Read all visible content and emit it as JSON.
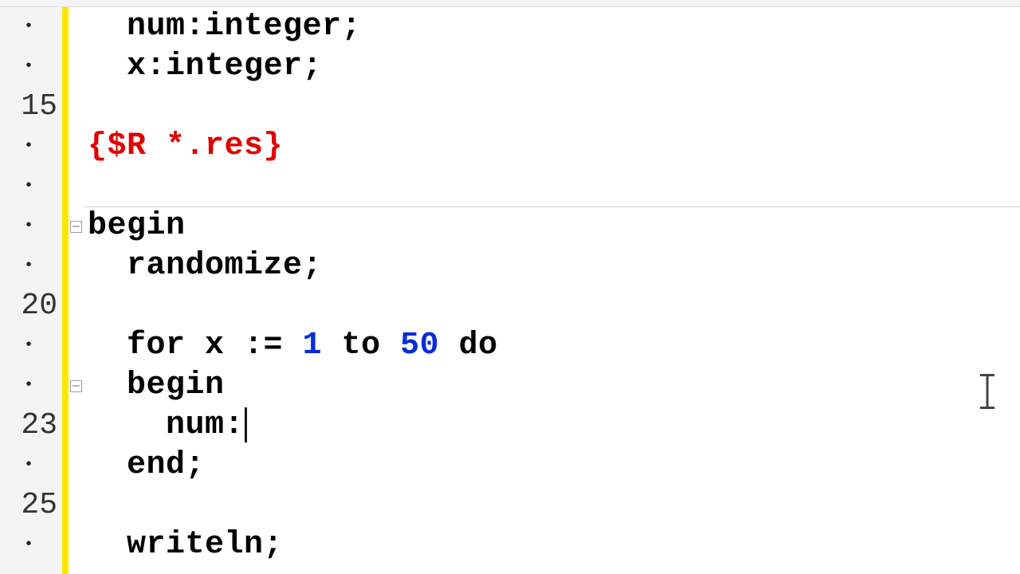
{
  "gutter": {
    "labels": [
      "·",
      "·",
      "15",
      "·",
      "·",
      "·",
      "·",
      "20",
      "·",
      "·",
      "23",
      "·",
      "25",
      "·"
    ]
  },
  "fold": {
    "markers": [
      false,
      false,
      false,
      false,
      false,
      true,
      false,
      false,
      false,
      true,
      false,
      false,
      false,
      false
    ]
  },
  "separatorAfterIndex": 4,
  "code": {
    "lines": [
      [
        {
          "cls": "tok-plain",
          "pre": "  ",
          "t": "num"
        },
        {
          "cls": "tok-punct",
          "t": ":"
        },
        {
          "cls": "tok-plain",
          "t": "integer"
        },
        {
          "cls": "tok-punct",
          "t": ";"
        }
      ],
      [
        {
          "cls": "tok-plain",
          "pre": "  ",
          "t": "x"
        },
        {
          "cls": "tok-punct",
          "t": ":"
        },
        {
          "cls": "tok-plain",
          "t": "integer"
        },
        {
          "cls": "tok-punct",
          "t": ";"
        }
      ],
      [],
      [
        {
          "cls": "tok-dir",
          "t": "{$R *.res}"
        }
      ],
      [],
      [
        {
          "cls": "tok-kw",
          "t": "begin"
        }
      ],
      [
        {
          "cls": "tok-plain",
          "pre": "  ",
          "t": "randomize"
        },
        {
          "cls": "tok-punct",
          "t": ";"
        }
      ],
      [],
      [
        {
          "cls": "tok-kw",
          "pre": "  ",
          "t": "for"
        },
        {
          "cls": "tok-plain",
          "t": " x "
        },
        {
          "cls": "tok-punct",
          "t": ":="
        },
        {
          "cls": "tok-plain",
          "t": " "
        },
        {
          "cls": "tok-num",
          "t": "1"
        },
        {
          "cls": "tok-plain",
          "t": " "
        },
        {
          "cls": "tok-kw",
          "t": "to"
        },
        {
          "cls": "tok-plain",
          "t": " "
        },
        {
          "cls": "tok-num",
          "t": "50"
        },
        {
          "cls": "tok-plain",
          "t": " "
        },
        {
          "cls": "tok-kw",
          "t": "do"
        }
      ],
      [
        {
          "cls": "tok-kw",
          "pre": "  ",
          "t": "begin"
        }
      ],
      [
        {
          "cls": "tok-plain",
          "pre": "    ",
          "t": "num"
        },
        {
          "cls": "tok-punct",
          "t": ":"
        },
        {
          "caret": true
        }
      ],
      [
        {
          "cls": "tok-kw",
          "pre": "  ",
          "t": "end"
        },
        {
          "cls": "tok-punct",
          "t": ";"
        }
      ],
      [],
      [
        {
          "cls": "tok-plain",
          "pre": "  ",
          "t": "writeln"
        },
        {
          "cls": "tok-punct",
          "t": ";"
        }
      ]
    ]
  }
}
